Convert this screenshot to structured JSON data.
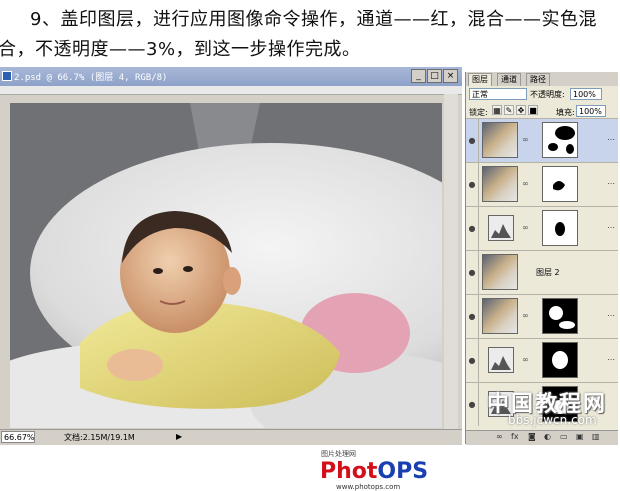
{
  "caption": {
    "line1": "9、盖印图层，进行应用图像命令操作，通道——红，混合——实色混",
    "line2": "合，不透明度——3%，到这一步操作完成。"
  },
  "document": {
    "title": "2.psd @ 66.7% (图层 4, RGB/8)",
    "status_zoom": "66.67%",
    "status_doc": "文档:2.15M/19.1M",
    "status_arrow": "▶",
    "logo_top": "图片处理网",
    "logo_part1": "Phot",
    "logo_part2": "OPS",
    "logo_url": "www.photops.com"
  },
  "window_buttons": {
    "minimize": "_",
    "maximize": "□",
    "close": "×"
  },
  "layers_panel": {
    "tabs": [
      "图层",
      "通道",
      "路径"
    ],
    "blend_mode": "正常",
    "opacity_label": "不透明度:",
    "opacity_value": "100%",
    "lock_label": "锁定:",
    "fill_label": "填充:",
    "fill_value": "100%",
    "layers": [
      {
        "name": "",
        "selected": true,
        "thumb": "photo",
        "has_mask": true
      },
      {
        "name": "",
        "selected": false,
        "thumb": "photo",
        "has_mask": true
      },
      {
        "name": "",
        "selected": false,
        "thumb": "adjustment",
        "has_mask": true
      },
      {
        "name": "图层 2",
        "selected": false,
        "thumb": "photo",
        "has_mask": false
      },
      {
        "name": "",
        "selected": false,
        "thumb": "photo",
        "has_mask": true
      },
      {
        "name": "",
        "selected": false,
        "thumb": "adjustment",
        "has_mask": true
      },
      {
        "name": "",
        "selected": false,
        "thumb": "adjustment",
        "has_mask": true
      }
    ],
    "bottom_icons": [
      "link-icon",
      "fx-icon",
      "mask-icon",
      "adjustment-icon",
      "folder-icon",
      "new-layer-icon",
      "trash-icon"
    ]
  },
  "watermark": {
    "text": "中国教程网",
    "url": "bbs.jcwcn.com"
  },
  "colors": {
    "titlebar": "#8ea2c8",
    "panel_bg": "#ece9d8",
    "selected_layer": "#c8d4ec"
  }
}
